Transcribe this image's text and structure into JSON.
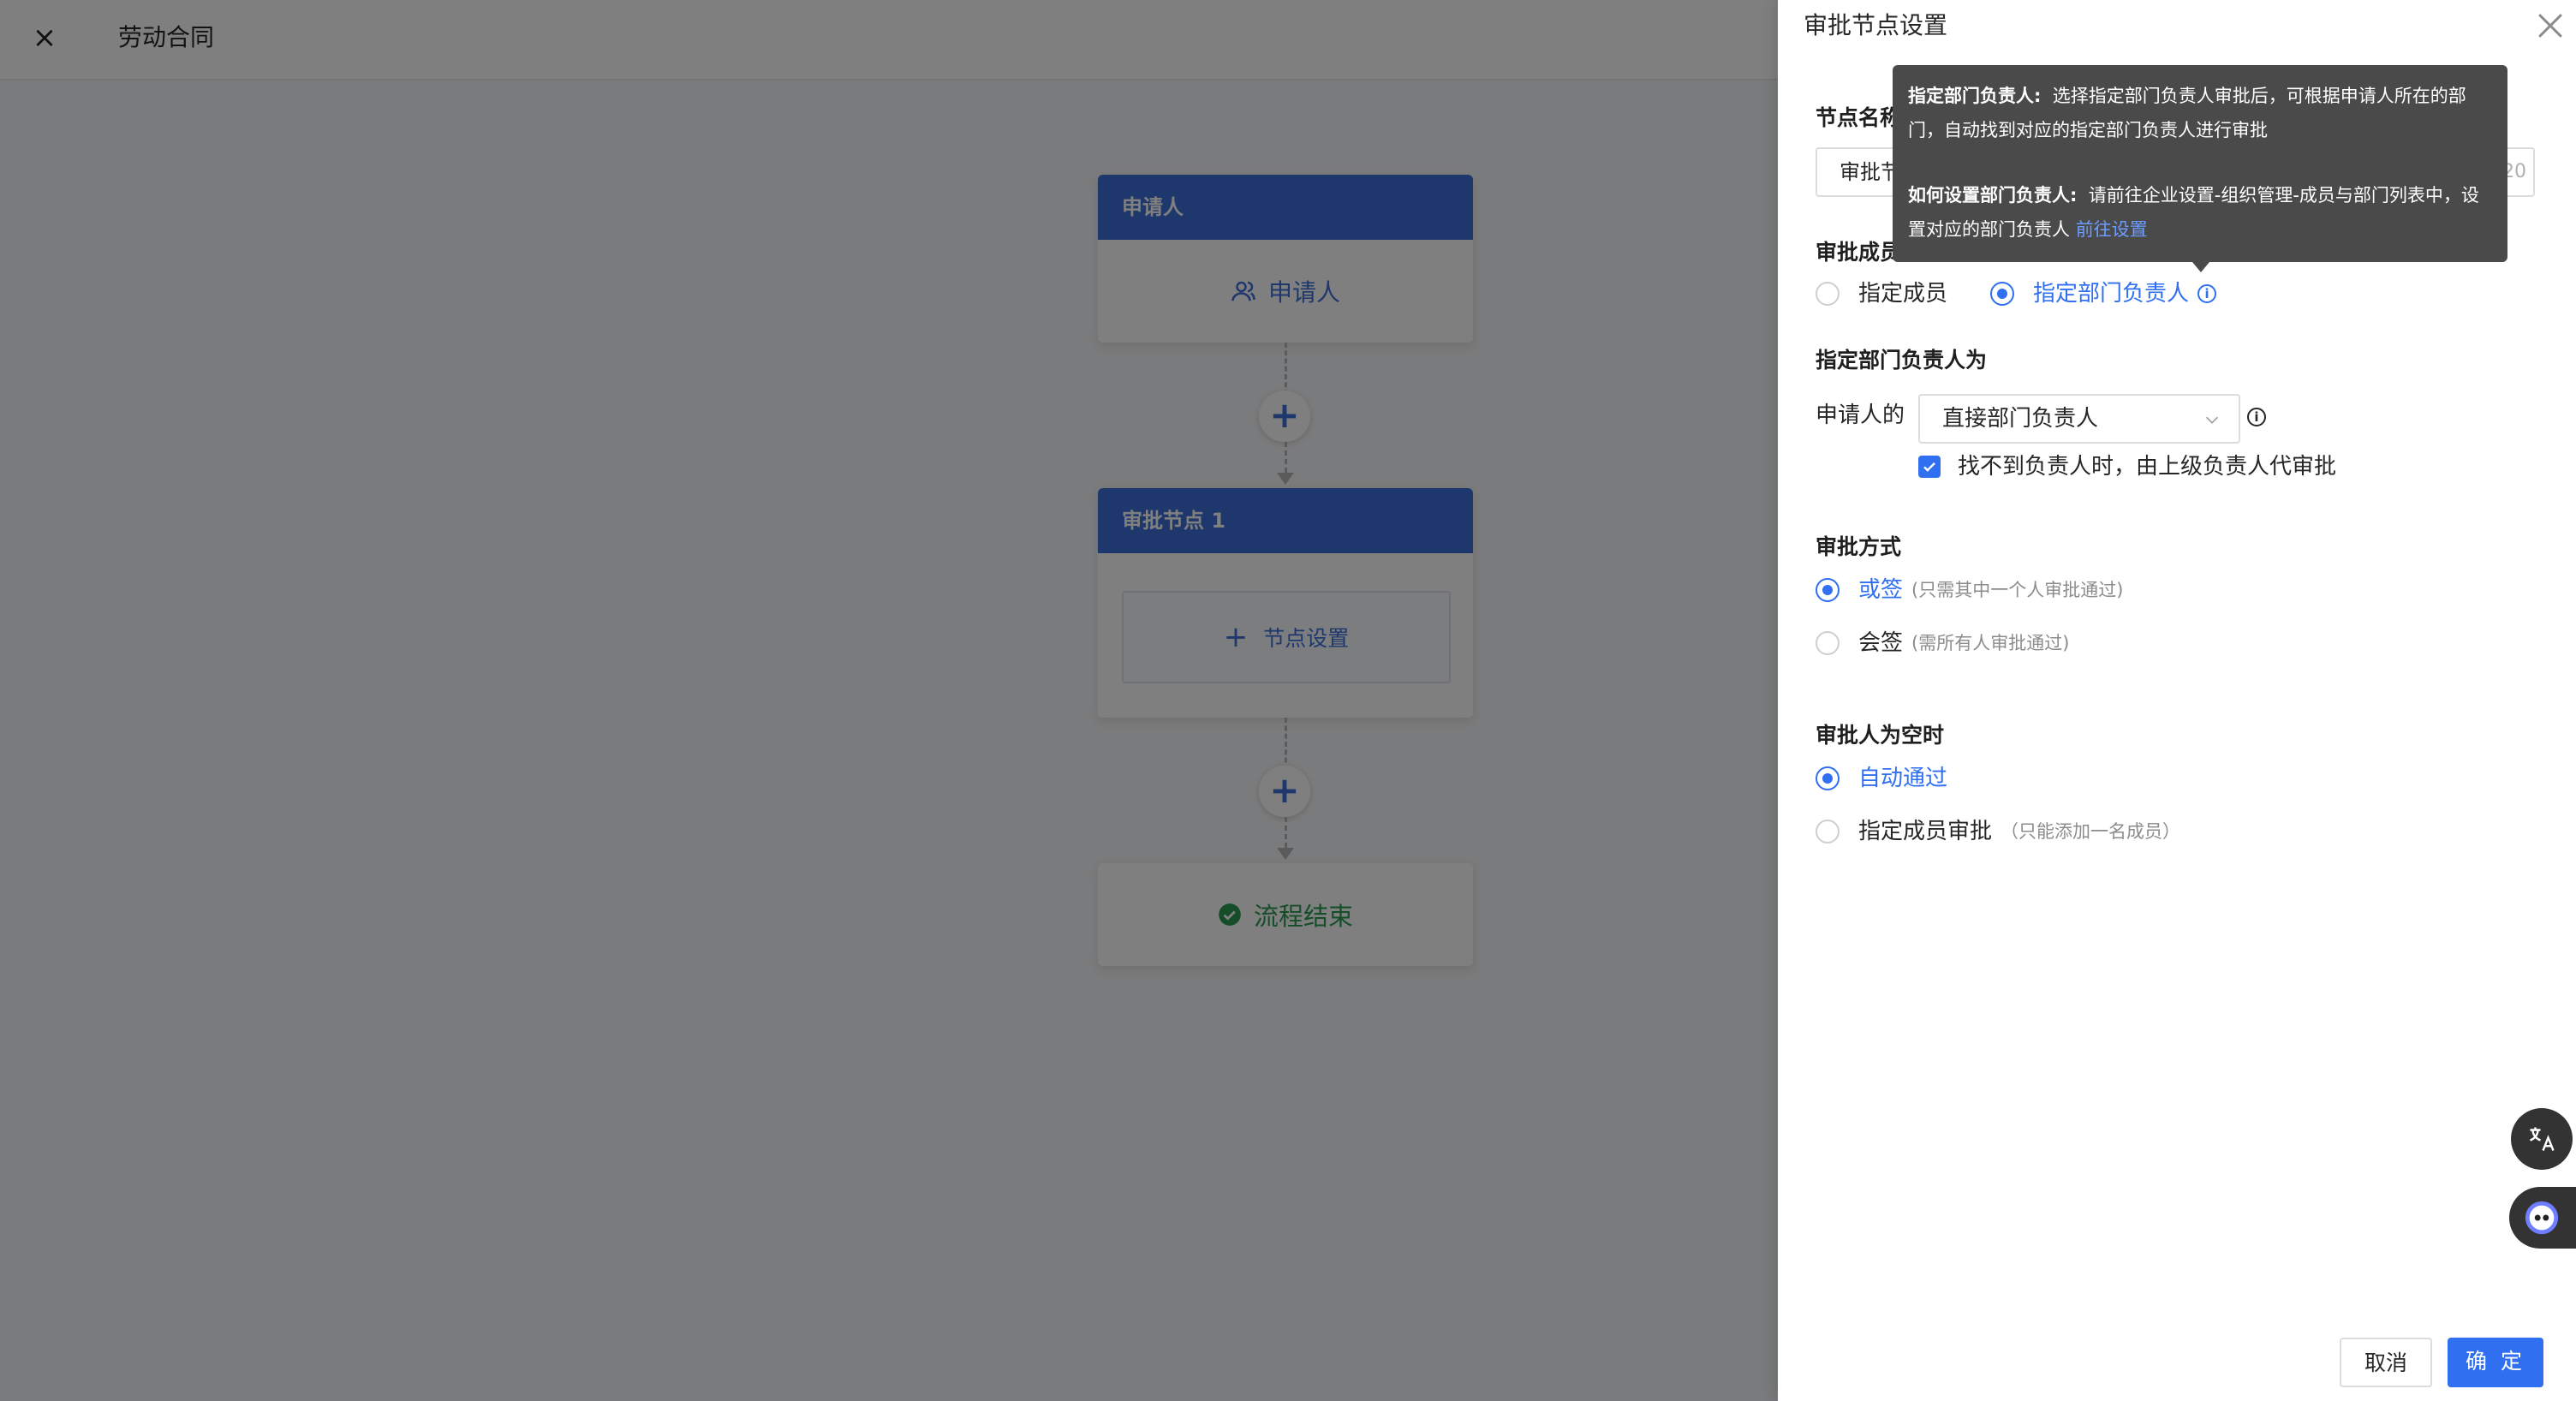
{
  "header": {
    "close_icon": "×",
    "title": "劳动合同"
  },
  "flow": {
    "applicant_card": {
      "title": "申请人",
      "body": "申请人"
    },
    "add_icon": "+",
    "node_card": {
      "title": "审批节点 1",
      "set_label": "节点设置",
      "set_icon": "+"
    },
    "end_card": {
      "label": "流程结束"
    }
  },
  "drawer": {
    "title": "审批节点设置",
    "node_name": {
      "label": "节点名称",
      "value": "审批节点1",
      "count": "20"
    },
    "members": {
      "label": "审批成员",
      "options": [
        {
          "label": "指定成员",
          "selected": false
        },
        {
          "label": "指定部门负责人",
          "selected": true
        }
      ]
    },
    "dept_head": {
      "label": "指定部门负责人为",
      "prefix": "申请人的",
      "select_value": "直接部门负责人",
      "fallback_label": "找不到负责人时，由上级负责人代审批",
      "fallback_checked": true
    },
    "method": {
      "label": "审批方式",
      "options": [
        {
          "label": "或签",
          "note": "(只需其中一个人审批通过)",
          "selected": true
        },
        {
          "label": "会签",
          "note": "(需所有人审批通过)",
          "selected": false
        }
      ]
    },
    "empty": {
      "label": "审批人为空时",
      "options": [
        {
          "label": "自动通过",
          "note": "",
          "selected": true
        },
        {
          "label": "指定成员审批",
          "note": "（只能添加一名成员）",
          "selected": false
        }
      ]
    },
    "cancel_label": "取消",
    "ok_label": "确 定"
  },
  "tooltip": {
    "title1": "指定部门负责人:",
    "text1": "选择指定部门负责人审批后，可根据申请人所在的部门，自动找到对应的指定部门负责人进行审批",
    "title2": "如何设置部门负责人:",
    "text2": "请前往企业设置-组织管理-成员与部门列表中，设置对应的部门负责人",
    "link": "前往设置"
  },
  "colors": {
    "accent": "#2f6ff0",
    "card_head": "#3d6fd9",
    "success": "#2c9a52",
    "tooltip_bg": "#4a4a4a"
  },
  "icons": [
    "close-icon",
    "user-icon",
    "plus-icon",
    "check-circle-icon",
    "info-icon",
    "chevron-down-icon",
    "translate-icon",
    "bot-icon"
  ]
}
